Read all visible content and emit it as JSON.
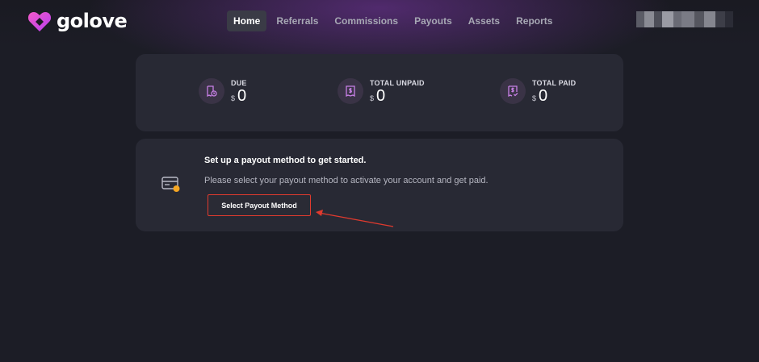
{
  "brand": {
    "name": "golove",
    "accent": "#d64ddf"
  },
  "nav": {
    "items": [
      {
        "label": "Home",
        "active": true
      },
      {
        "label": "Referrals",
        "active": false
      },
      {
        "label": "Commissions",
        "active": false
      },
      {
        "label": "Payouts",
        "active": false
      },
      {
        "label": "Assets",
        "active": false
      },
      {
        "label": "Reports",
        "active": false
      }
    ]
  },
  "stats": [
    {
      "label": "DUE",
      "currency": "$",
      "value": "0",
      "icon": "receipt-clock-icon"
    },
    {
      "label": "TOTAL UNPAID",
      "currency": "$",
      "value": "0",
      "icon": "dollar-receipt-icon"
    },
    {
      "label": "TOTAL PAID",
      "currency": "$",
      "value": "0",
      "icon": "dollar-receipt-check-icon"
    }
  ],
  "payout": {
    "title": "Set up a payout method to get started.",
    "description": "Please select your payout method to activate your account and get paid.",
    "button_label": "Select Payout Method",
    "icon": "credit-card-pending-icon"
  },
  "annotation": {
    "color": "#e03a2e"
  }
}
